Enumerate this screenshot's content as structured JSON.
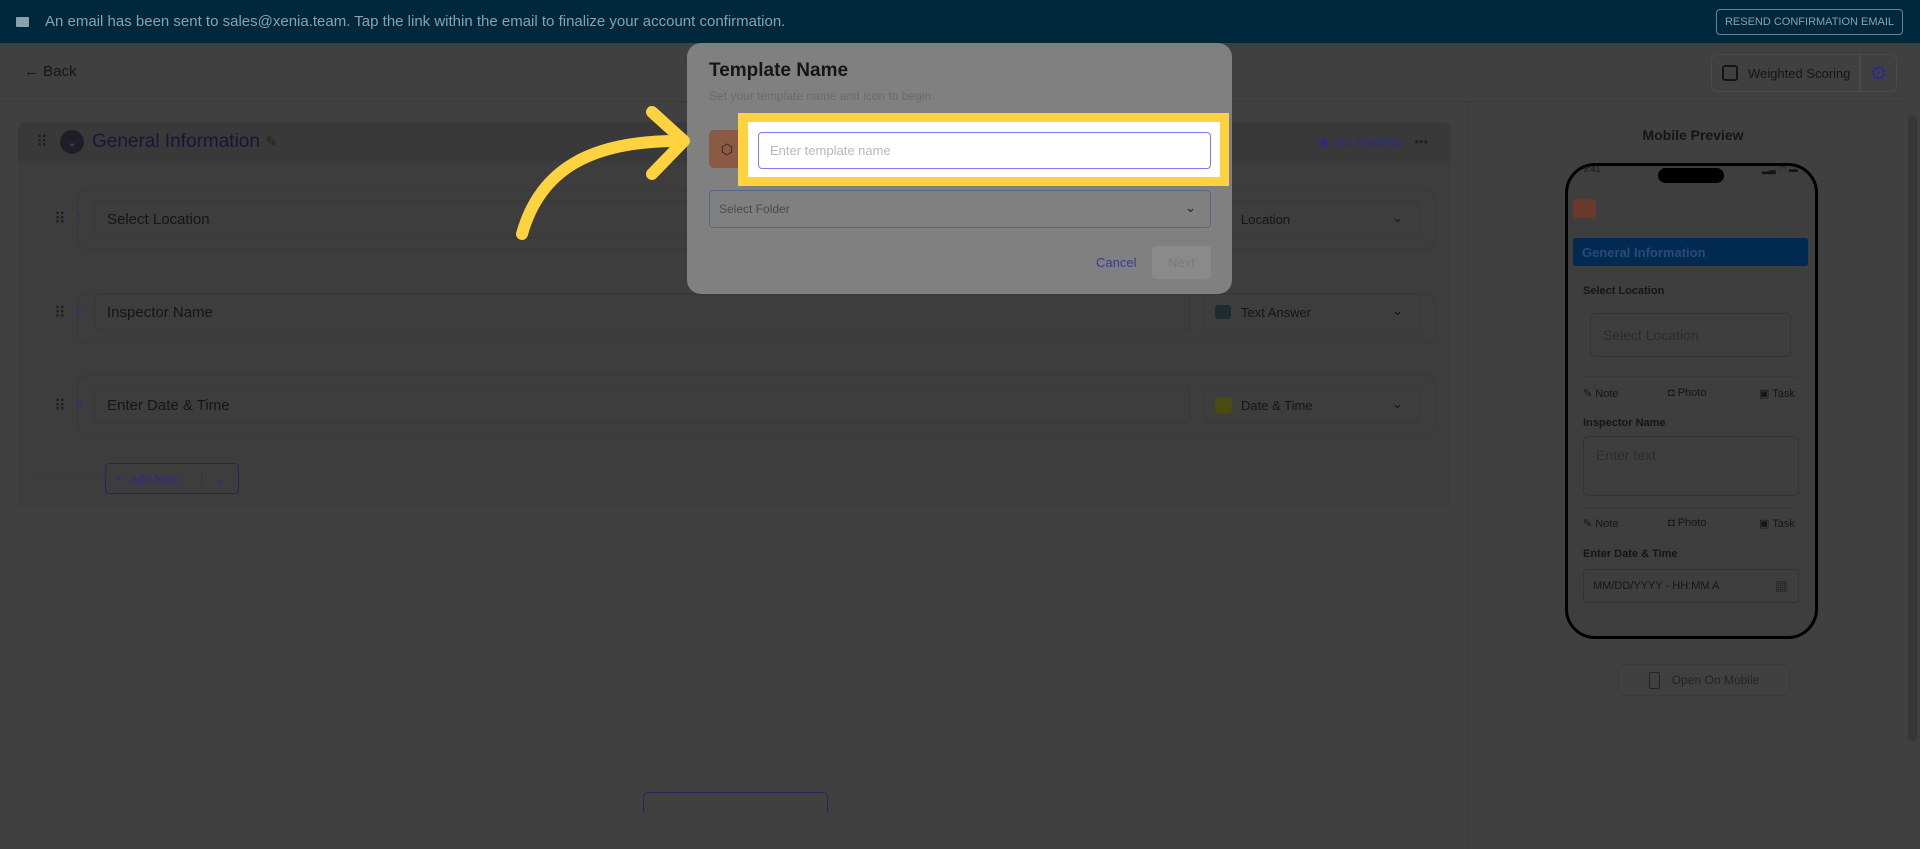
{
  "banner": {
    "message": "An email has been sent to sales@xenia.team. Tap the link within the email to finalize your account confirmation.",
    "resend_label": "RESEND CONFIRMATION EMAIL"
  },
  "header": {
    "back_label": "Back",
    "weighted_scoring_label": "Weighted Scoring"
  },
  "section": {
    "title": "General Information",
    "set_visibility_label": "Set Visibility",
    "items": [
      {
        "number": "1",
        "title": "Select Location",
        "type": "Location"
      },
      {
        "number": "2",
        "title": "Inspector Name",
        "type": "Text Answer"
      },
      {
        "number": "3",
        "title": "Enter Date & Time",
        "type": "Date & Time"
      }
    ],
    "add_new_label": "Add New"
  },
  "preview": {
    "title": "Mobile Preview",
    "time": "9:41",
    "section_title": "General Information",
    "q1_label": "Select Location",
    "q1_placeholder": "Select Location",
    "q2_label": "Inspector Name",
    "q2_placeholder": "Enter text",
    "q3_label": "Enter Date & Time",
    "q3_placeholder": "MM/DD/YYYY - HH:MM A",
    "note_label": "Note",
    "photo_label": "Photo",
    "task_label": "Task",
    "open_mobile_label": "Open On Mobile"
  },
  "modal": {
    "title": "Template Name",
    "subtitle": "Set your template name and icon to begin.",
    "name_placeholder": "Enter template name",
    "name_value": "",
    "folder_placeholder": "Select Folder",
    "cancel_label": "Cancel",
    "next_label": "Next"
  },
  "colors": {
    "banner": "#00283d",
    "highlight": "#ffd23f",
    "accent": "#2b2a8a"
  }
}
